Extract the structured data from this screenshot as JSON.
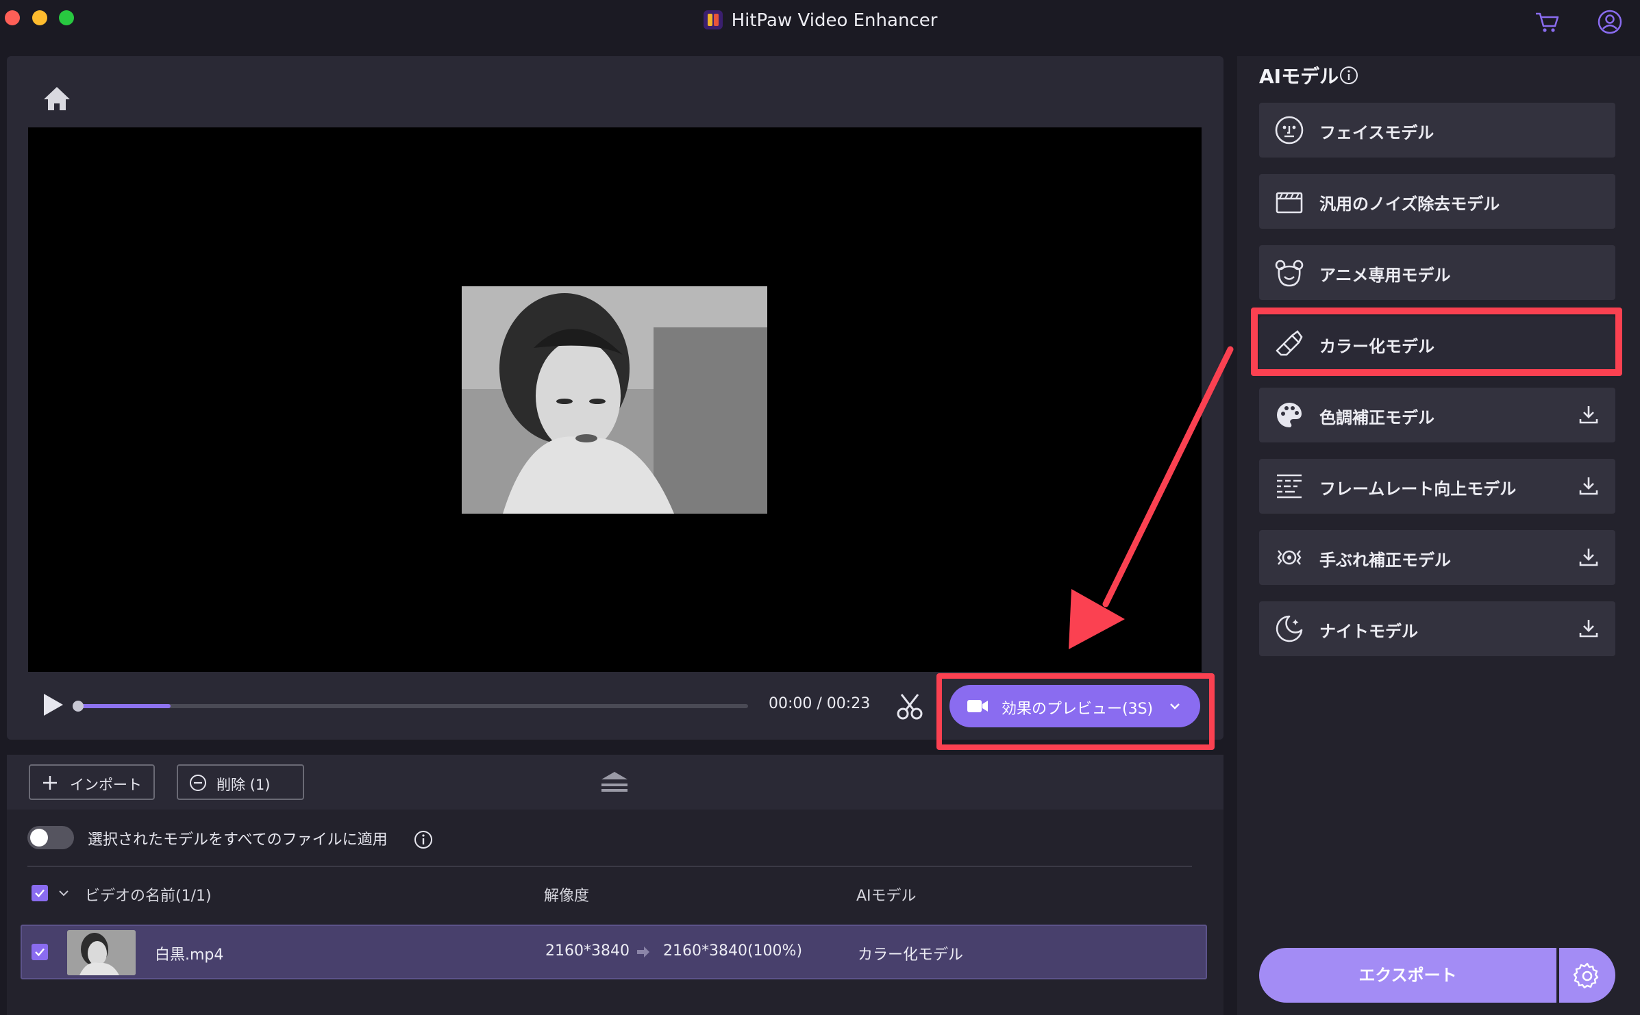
{
  "app": {
    "title": "HitPaw Video Enhancer"
  },
  "player": {
    "time": "00:00 / 00:23",
    "progress_fraction": 0.14,
    "preview_button": "効果のプレビュー(3S)"
  },
  "toolbar": {
    "import_label": "インポート",
    "delete_label": "削除 (1)"
  },
  "apply_all": {
    "label": "選択されたモデルをすべてのファイルに適用",
    "enabled": false
  },
  "file_table": {
    "columns": {
      "name": "ビデオの名前(1/1)",
      "resolution": "解像度",
      "model": "AIモデル"
    },
    "rows": [
      {
        "checked": true,
        "name": "白黒.mp4",
        "resolution_from": "2160*3840",
        "resolution_to": "2160*3840(100%)",
        "model": "カラー化モデル"
      }
    ]
  },
  "sidebar": {
    "title": "AIモデル",
    "models": [
      {
        "label": "フェイスモデル",
        "icon": "face-icon",
        "download": false
      },
      {
        "label": "汎用のノイズ除去モデル",
        "icon": "clapperboard-icon",
        "download": false
      },
      {
        "label": "アニメ専用モデル",
        "icon": "bear-icon",
        "download": false
      },
      {
        "label": "カラー化モデル",
        "icon": "eraser-icon",
        "download": false,
        "selected": true
      },
      {
        "label": "色調補正モデル",
        "icon": "palette-icon",
        "download": true
      },
      {
        "label": "フレームレート向上モデル",
        "icon": "frames-icon",
        "download": true
      },
      {
        "label": "手ぶれ補正モデル",
        "icon": "stabilize-icon",
        "download": true
      },
      {
        "label": "ナイトモデル",
        "icon": "moon-icon",
        "download": true
      }
    ],
    "export_label": "エクスポート"
  },
  "colors": {
    "accent": "#8a6cf0",
    "export": "#a38cf5",
    "highlight": "#fb4151",
    "background": "#1b1a23"
  }
}
